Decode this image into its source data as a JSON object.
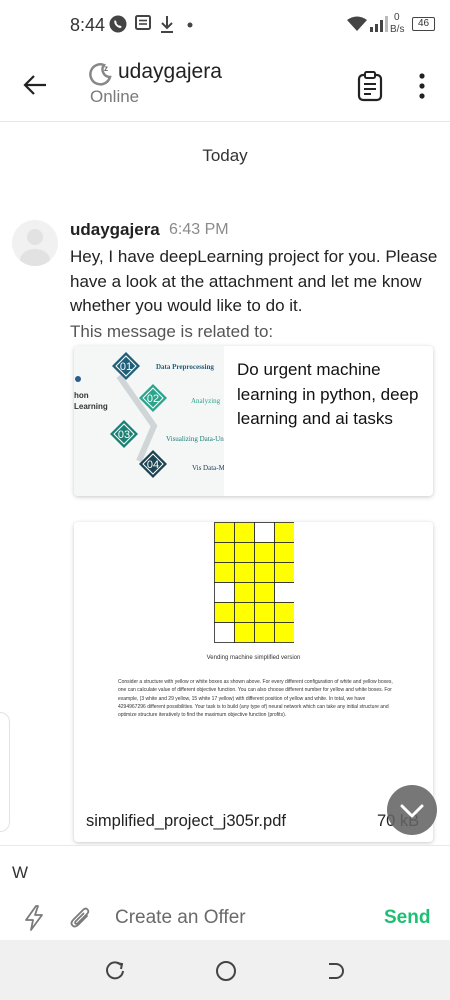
{
  "status_bar": {
    "time": "8:44",
    "net_speed_value": "0",
    "net_speed_unit": "B/s",
    "battery": "46"
  },
  "header": {
    "name": "udaygajera",
    "status": "Online"
  },
  "conversation": {
    "day_divider": "Today",
    "message": {
      "sender": "udaygajera",
      "time": "6:43 PM",
      "text": "Hey, I have deepLearning project for you. Please have a look at the attachment and let me know whether you would like to do it.",
      "related_label": "This message is related to:"
    },
    "gig": {
      "title": "Do urgent machine learning in python, deep learning and ai tasks",
      "thumbnail": {
        "steps": [
          {
            "num": "01",
            "label": "Data Preprocessing",
            "color": "#1f5f7a"
          },
          {
            "num": "02",
            "label": "Analyzing",
            "color": "#2aa58c"
          },
          {
            "num": "03",
            "label": "Visualizing Data-Univariate",
            "color": "#1b7f73"
          },
          {
            "num": "04",
            "label": "Vis Data-Mul",
            "color": "#1d4452"
          }
        ],
        "side_text_1": "hon",
        "side_text_2": "Learning"
      }
    },
    "attachment": {
      "file_name": "simplified_project_j305r.pdf",
      "file_size": "70 kB",
      "preview_caption": "Vending machine simplified version",
      "preview_text": "Consider a structure with yellow or white boxes as shown above. For every different configuration of white and yellow boxes, one can calculate value of different objective function. You can also choose different number for yellow and white boxes. For example, (3 white and 29 yellow, 15 white 17 yellow) with different position of yellow and white. In total, we have 4294967296 different possibilities. Your task is to build (any type of) neural network which can take any initial structure and optimize structure iteratively to find the maximum objective function (profits)."
    }
  },
  "composer": {
    "input_value": "W",
    "create_offer_label": "Create an Offer",
    "send_label": "Send"
  },
  "colors": {
    "accent": "#1dbf73",
    "grid_yellow": "#ffff00"
  },
  "icons": [
    "back-arrow-icon",
    "away-status-icon",
    "clipboard-icon",
    "more-vert-icon",
    "chevron-down-icon",
    "lightning-icon",
    "paperclip-icon",
    "recent-apps-icon",
    "home-icon",
    "back-nav-icon"
  ]
}
